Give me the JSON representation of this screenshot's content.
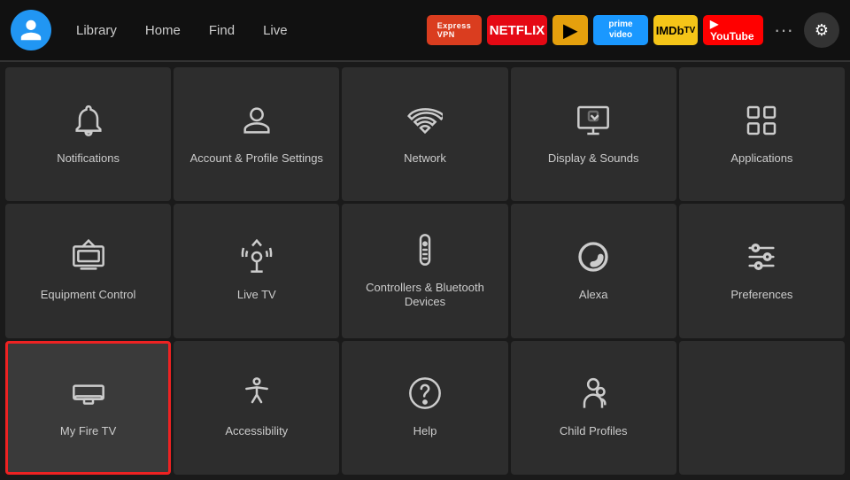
{
  "nav": {
    "links": [
      "Library",
      "Home",
      "Find",
      "Live"
    ],
    "apps": [
      {
        "label": "ExpressVPN",
        "class": "badge-expressvpn"
      },
      {
        "label": "NETFLIX",
        "class": "badge-netflix"
      },
      {
        "label": "▶",
        "class": "badge-plex"
      },
      {
        "label": "prime video",
        "class": "badge-prime"
      },
      {
        "label": "IMDb TV",
        "class": "badge-imdb"
      },
      {
        "label": "▶ YouTube",
        "class": "badge-youtube"
      }
    ],
    "more_label": "···",
    "settings_icon": "⚙"
  },
  "grid": {
    "cells": [
      {
        "id": "notifications",
        "label": "Notifications",
        "icon": "bell",
        "selected": false
      },
      {
        "id": "account-profile",
        "label": "Account & Profile Settings",
        "icon": "person",
        "selected": false
      },
      {
        "id": "network",
        "label": "Network",
        "icon": "wifi",
        "selected": false
      },
      {
        "id": "display-sounds",
        "label": "Display & Sounds",
        "icon": "display-sound",
        "selected": false
      },
      {
        "id": "applications",
        "label": "Applications",
        "icon": "apps",
        "selected": false
      },
      {
        "id": "equipment-control",
        "label": "Equipment Control",
        "icon": "tv",
        "selected": false
      },
      {
        "id": "live-tv",
        "label": "Live TV",
        "icon": "antenna",
        "selected": false
      },
      {
        "id": "controllers-bluetooth",
        "label": "Controllers & Bluetooth Devices",
        "icon": "remote",
        "selected": false
      },
      {
        "id": "alexa",
        "label": "Alexa",
        "icon": "alexa",
        "selected": false
      },
      {
        "id": "preferences",
        "label": "Preferences",
        "icon": "sliders",
        "selected": false
      },
      {
        "id": "my-fire-tv",
        "label": "My Fire TV",
        "icon": "firetv",
        "selected": true
      },
      {
        "id": "accessibility",
        "label": "Accessibility",
        "icon": "accessibility",
        "selected": false
      },
      {
        "id": "help",
        "label": "Help",
        "icon": "help",
        "selected": false
      },
      {
        "id": "child-profiles",
        "label": "Child Profiles",
        "icon": "child",
        "selected": false
      },
      {
        "id": "empty",
        "label": "",
        "icon": "",
        "selected": false
      }
    ]
  }
}
